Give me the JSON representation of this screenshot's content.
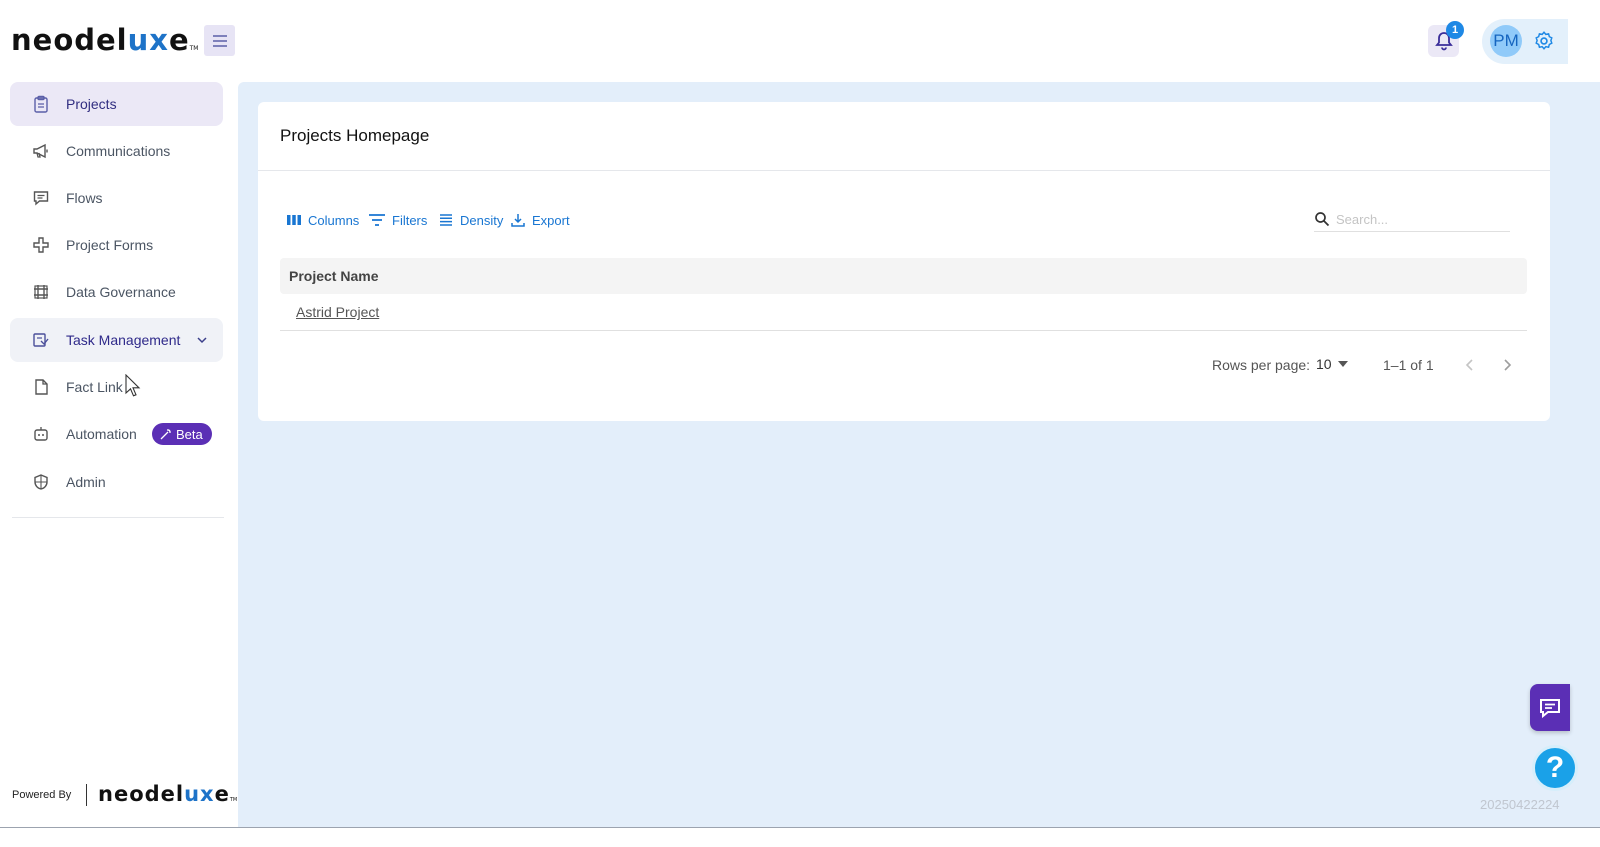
{
  "header": {
    "logo_main": "neodel",
    "logo_ux": "ux",
    "logo_end": "e",
    "logo_tm": "TM",
    "notification_count": "1",
    "avatar_initials": "PM"
  },
  "sidebar": {
    "items": [
      {
        "label": "Projects"
      },
      {
        "label": "Communications"
      },
      {
        "label": "Flows"
      },
      {
        "label": "Project Forms"
      },
      {
        "label": "Data Governance"
      },
      {
        "label": "Task Management"
      },
      {
        "label": "Fact Link"
      },
      {
        "label": "Automation",
        "badge": "Beta"
      },
      {
        "label": "Admin"
      }
    ],
    "powered_by": "Powered By"
  },
  "main": {
    "title": "Projects Homepage",
    "toolbar": {
      "columns": "Columns",
      "filters": "Filters",
      "density": "Density",
      "export": "Export",
      "search_placeholder": "Search..."
    },
    "table": {
      "headers": [
        "Project Name"
      ],
      "rows": [
        [
          "Astrid Project"
        ]
      ]
    },
    "pagination": {
      "rows_per_page_label": "Rows per page:",
      "rows_per_page_value": "10",
      "range": "1–1 of 1"
    },
    "build_id": "20250422224"
  },
  "colors": {
    "accent": "#1976d2",
    "brand_purple": "#5b2fb5",
    "main_bg": "#e3eefa"
  },
  "icons": [
    "menu-icon",
    "bell-icon",
    "gear-icon",
    "clipboard-icon",
    "megaphone-icon",
    "message-icon",
    "forms-icon",
    "grid-icon",
    "task-icon",
    "file-icon",
    "robot-icon",
    "shield-icon",
    "columns-icon",
    "filter-icon",
    "density-icon",
    "export-icon",
    "search-icon",
    "chat-icon",
    "help-icon"
  ]
}
